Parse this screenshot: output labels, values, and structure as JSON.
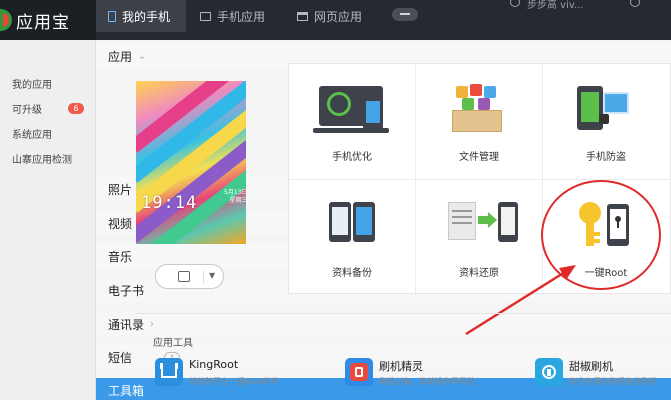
{
  "app": {
    "name": "应用宝"
  },
  "tabs": [
    {
      "label": "我的手机",
      "icon": "phone-icon",
      "active": true
    },
    {
      "label": "手机应用",
      "icon": "app-box-icon",
      "active": false
    },
    {
      "label": "网页应用",
      "icon": "web-page-icon",
      "active": false
    }
  ],
  "account": {
    "name": "步步高 viv..."
  },
  "sidebar": {
    "items": [
      {
        "label": "应用",
        "type": "group",
        "chevron": "⌄"
      },
      {
        "label": "我的应用",
        "type": "sub"
      },
      {
        "label": "可升级",
        "type": "sub",
        "badge": "6"
      },
      {
        "label": "系统应用",
        "type": "sub"
      },
      {
        "label": "山寨应用检测",
        "type": "sub"
      },
      {
        "label": "照片",
        "type": "group",
        "chevron": "›"
      },
      {
        "label": "视频",
        "type": "group"
      },
      {
        "label": "音乐",
        "type": "group"
      },
      {
        "label": "电子书",
        "type": "group"
      },
      {
        "label": "通讯录",
        "type": "group",
        "chevron": "›"
      },
      {
        "label": "短信",
        "type": "group",
        "badge": "1"
      },
      {
        "label": "工具箱",
        "type": "group",
        "active": true
      }
    ]
  },
  "device": {
    "time": "19:14",
    "date": "5月13日",
    "weekday": "星期三"
  },
  "tools": [
    {
      "label": "手机优化",
      "icon": "phone-optimize-icon"
    },
    {
      "label": "文件管理",
      "icon": "file-manager-icon"
    },
    {
      "label": "手机防盗",
      "icon": "anti-theft-icon"
    },
    {
      "label": "资料备份",
      "icon": "data-backup-icon"
    },
    {
      "label": "资料还原",
      "icon": "data-restore-icon"
    },
    {
      "label": "一键Root",
      "icon": "one-click-root-icon"
    }
  ],
  "section": {
    "title": "应用工具"
  },
  "apps": [
    {
      "name": "KingRoot",
      "desc": "首款跨平台一键Root软件",
      "color": "#2b8fe0"
    },
    {
      "name": "刷机精灵",
      "desc": "刷机必备，简单操作零风险",
      "color": "#2f8be6"
    },
    {
      "name": "甜椒刷机",
      "desc": "安全免费的数据备份刷机",
      "color": "#2aa7e0"
    }
  ],
  "colors": {
    "accent": "#3a9ae9",
    "topbar": "#262a30",
    "annotation": "#e02a2a"
  }
}
